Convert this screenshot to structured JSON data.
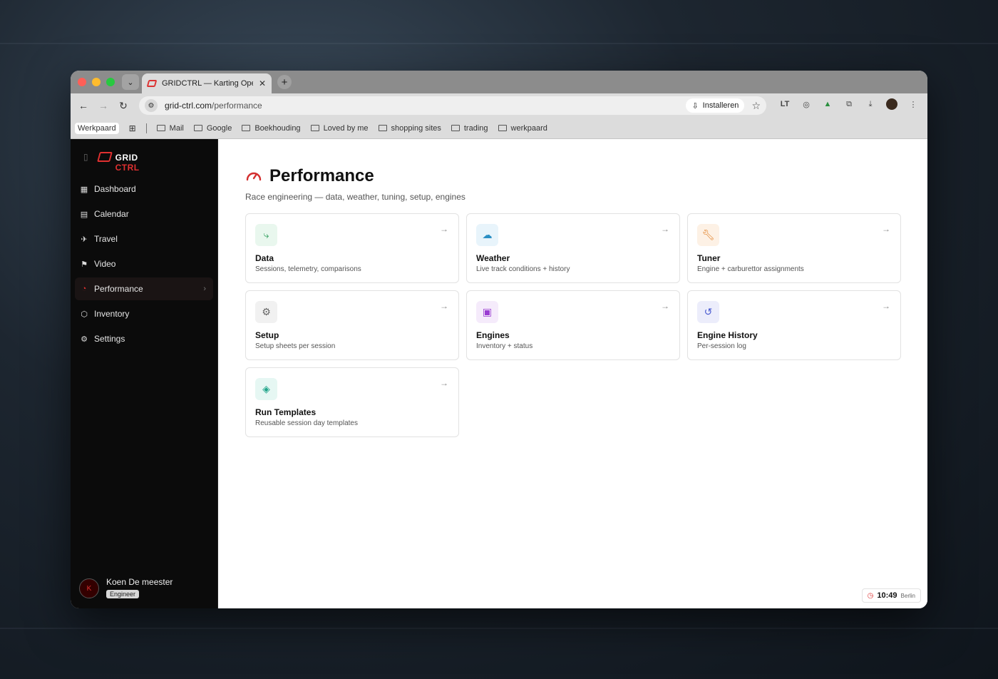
{
  "browser": {
    "tab_title": "GRIDCTRL — Karting Operatio",
    "url_host": "grid-ctrl.com",
    "url_path": "/performance",
    "install_label": "Installeren",
    "profile_label": "Werkpaard",
    "bookmarks": [
      "Mail",
      "Google",
      "Boekhouding",
      "Loved by me",
      "shopping sites",
      "trading",
      "werkpaard"
    ]
  },
  "sidebar": {
    "brand_a": "GRID",
    "brand_b": "CTRL",
    "items": [
      {
        "label": "Dashboard",
        "icon": "grid-icon"
      },
      {
        "label": "Calendar",
        "icon": "calendar-icon"
      },
      {
        "label": "Travel",
        "icon": "plane-icon"
      },
      {
        "label": "Video",
        "icon": "flag-icon"
      },
      {
        "label": "Performance",
        "icon": "gauge-icon",
        "active": true
      },
      {
        "label": "Inventory",
        "icon": "box-icon"
      },
      {
        "label": "Settings",
        "icon": "gear-icon"
      }
    ],
    "user_name": "Koen De meester",
    "user_role": "Engineer",
    "user_initial": "K"
  },
  "page": {
    "title": "Performance",
    "subtitle": "Race engineering — data, weather, tuning, setup, engines"
  },
  "cards": [
    {
      "title": "Data",
      "desc": "Sessions, telemetry, comparisons",
      "icon": "route-icon",
      "color": "#2e9e5b",
      "bg": "#e9f7ee"
    },
    {
      "title": "Weather",
      "desc": "Live track conditions + history",
      "icon": "cloud-sun-icon",
      "color": "#2b8fc4",
      "bg": "#e8f4fb"
    },
    {
      "title": "Tuner",
      "desc": "Engine + carburettor assignments",
      "icon": "wrench-icon",
      "color": "#e07b1f",
      "bg": "#fdf1e5"
    },
    {
      "title": "Setup",
      "desc": "Setup sheets per session",
      "icon": "gear-icon",
      "color": "#666666",
      "bg": "#f1f1f1"
    },
    {
      "title": "Engines",
      "desc": "Inventory + status",
      "icon": "cpu-icon",
      "color": "#9a3dd1",
      "bg": "#f5ebfb"
    },
    {
      "title": "Engine History",
      "desc": "Per-session log",
      "icon": "history-icon",
      "color": "#4a5bd1",
      "bg": "#ecedfb"
    },
    {
      "title": "Run Templates",
      "desc": "Reusable session day templates",
      "icon": "layers-icon",
      "color": "#20a58a",
      "bg": "#e6f7f3"
    }
  ],
  "clock": {
    "time": "10:49",
    "location": "Berlin"
  },
  "colors": {
    "accent": "#e03030"
  }
}
